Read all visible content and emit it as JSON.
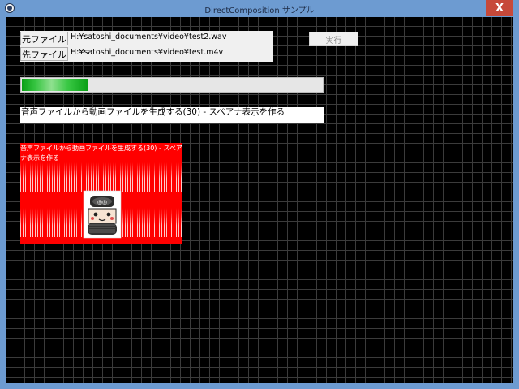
{
  "window": {
    "title": "DirectComposition サンプル",
    "close_glyph": "X"
  },
  "files": {
    "source_label": "元ファイル",
    "source_path": "H:¥satoshi_documents¥video¥test2.wav",
    "dest_label": "先ファイル",
    "dest_path": "H:¥satoshi_documents¥video¥test.m4v"
  },
  "execute": {
    "label": "実行"
  },
  "progress": {
    "fraction": 0.22,
    "color": "#0ba016"
  },
  "status": {
    "text": "音声ファイルから動画ファイルを生成する(30) - スペアナ表示を作る"
  },
  "preview": {
    "caption": "音声ファイルから動画ファイルを生成する(30) - スペアナ表示を作る",
    "background": "#ff0000",
    "image_icon": "mascot-character-icon"
  },
  "colors": {
    "titlebar": "#6d9bd1",
    "close_button": "#c7493a",
    "client_bg": "#000000",
    "grid": "#3b3b3b"
  }
}
